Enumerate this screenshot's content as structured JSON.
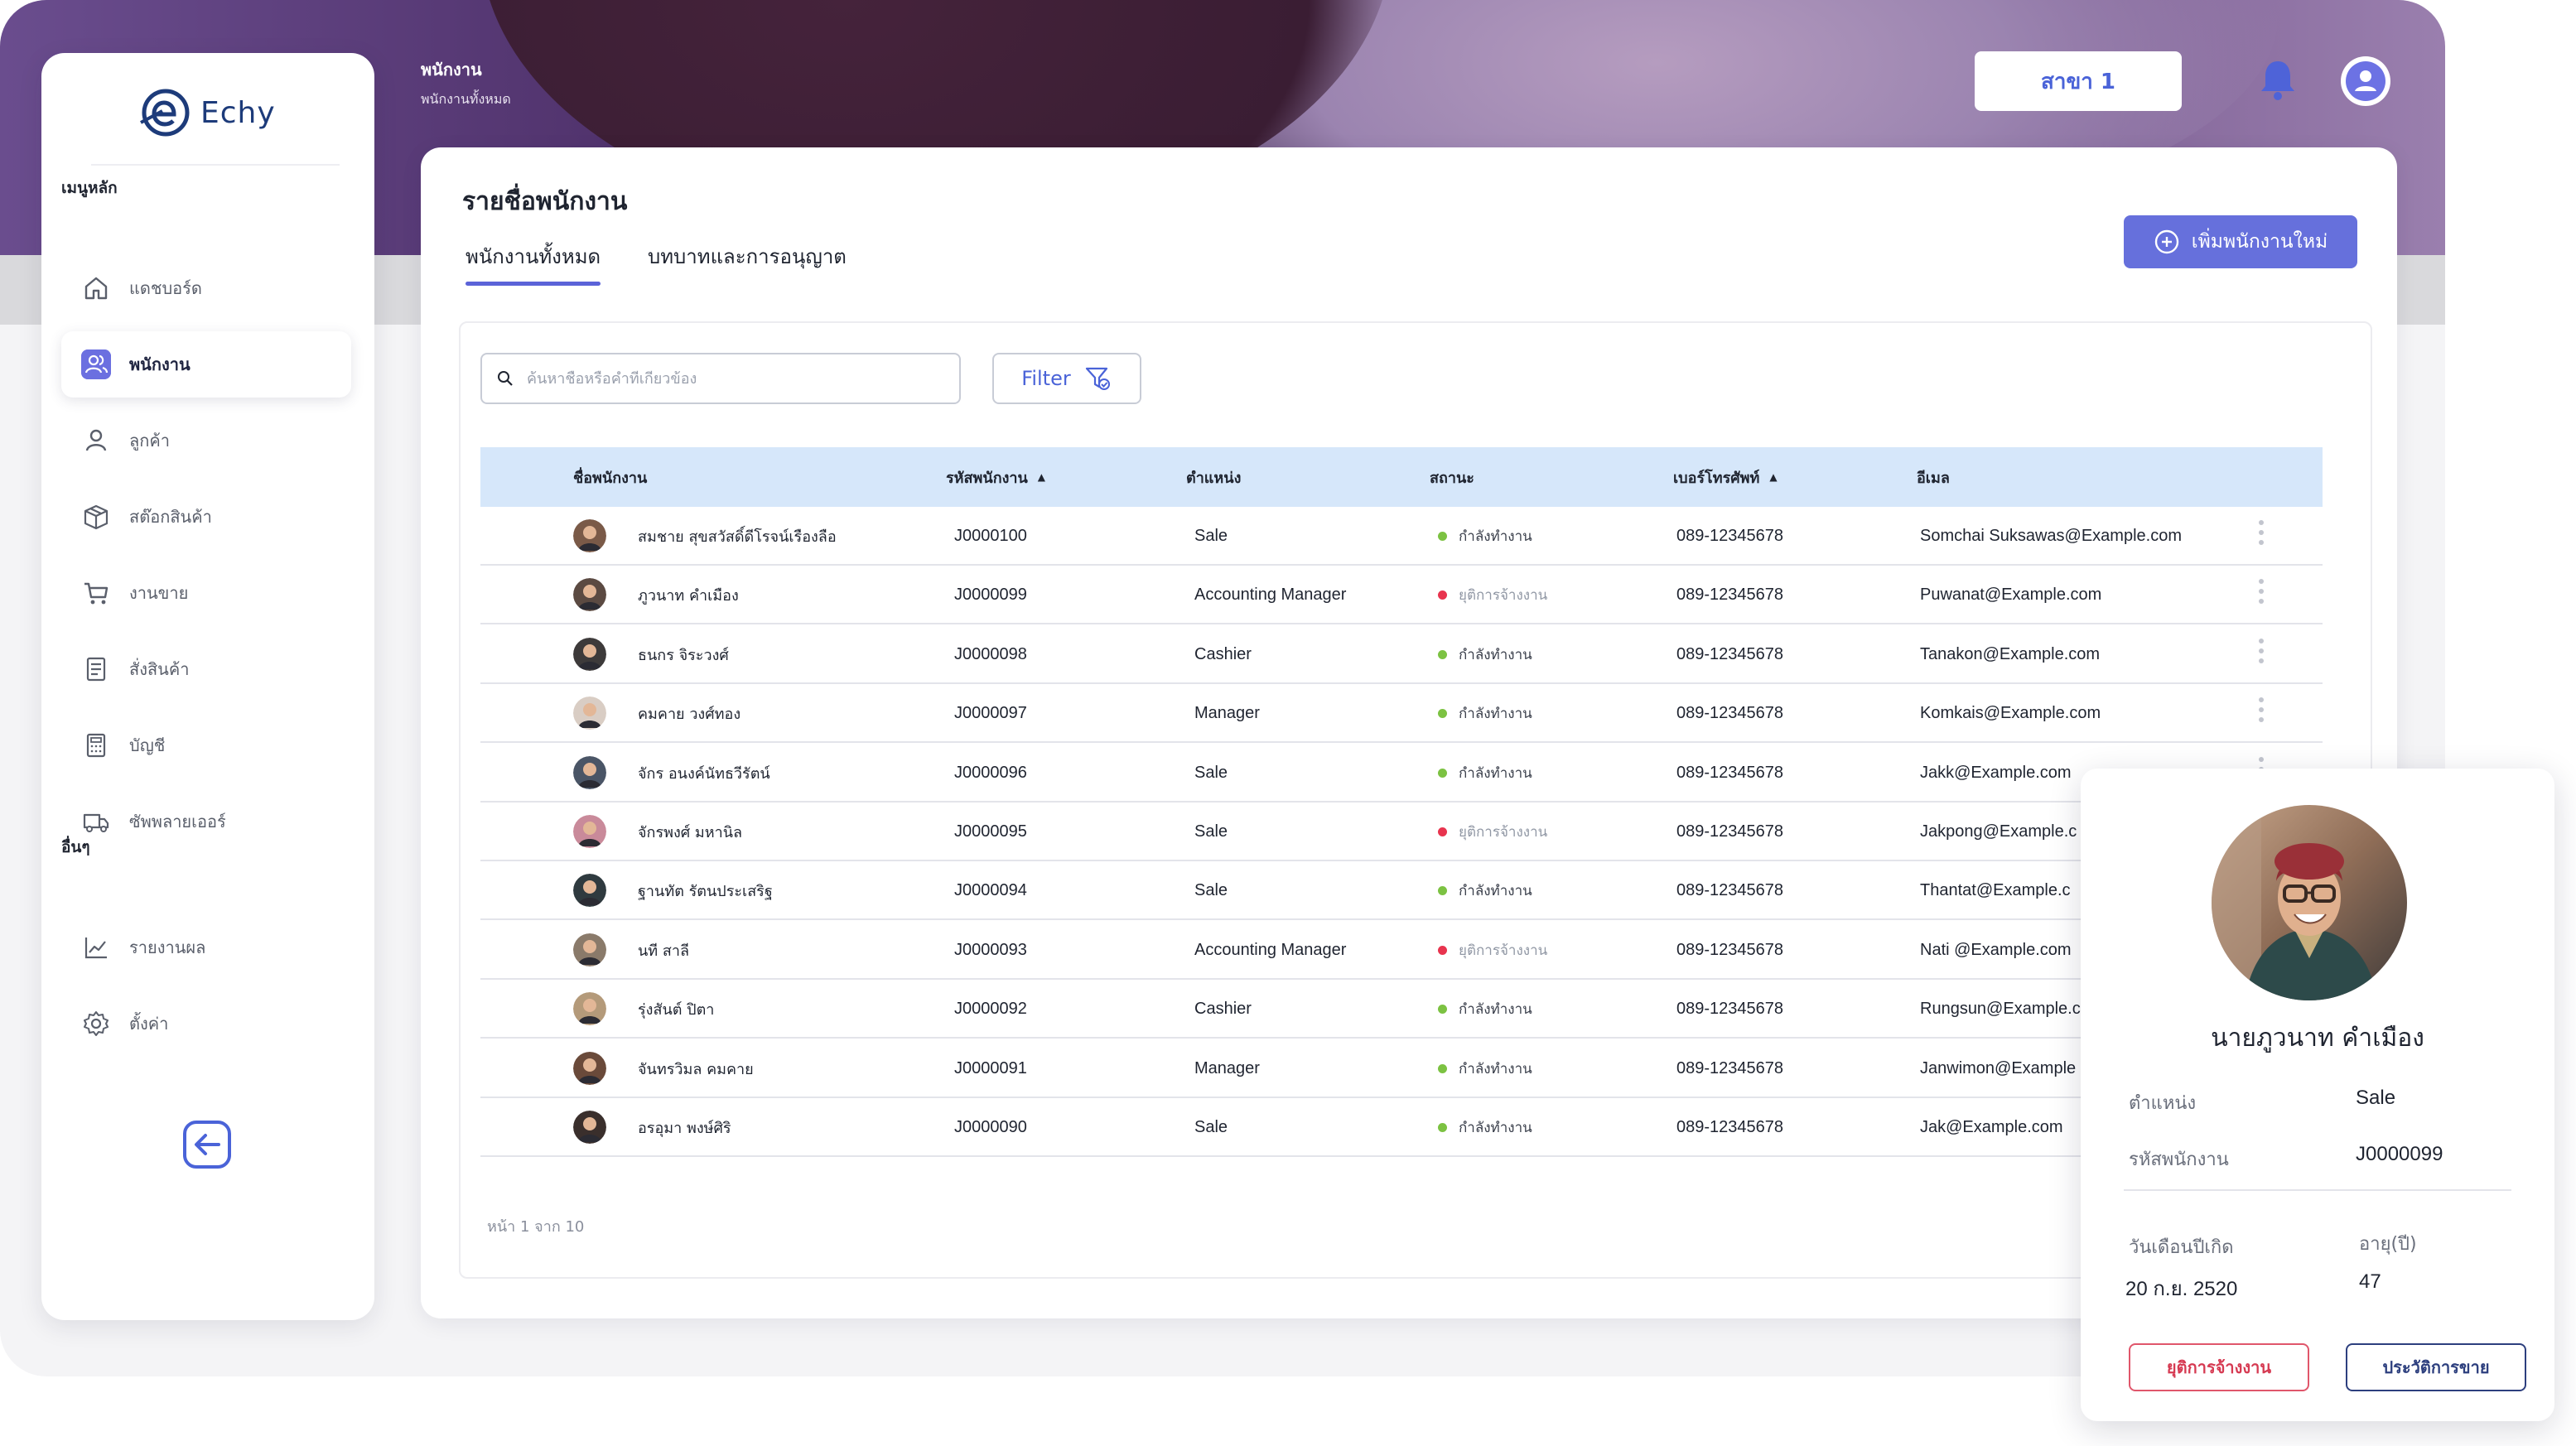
{
  "brand": {
    "name": "Echy",
    "color": "#1d3b7a"
  },
  "header": {
    "title": "พนักงาน",
    "subtitle": "พนักงานทั้งหมด",
    "branch_label": "สาขา 1"
  },
  "sidebar": {
    "section_main": "เมนูหลัก",
    "section_other": "อื่นๆ",
    "items": [
      {
        "label": "แดชบอร์ด",
        "icon": "home-icon"
      },
      {
        "label": "พนักงาน",
        "icon": "users-icon",
        "active": true
      },
      {
        "label": "ลูกค้า",
        "icon": "user-icon"
      },
      {
        "label": "สต๊อกสินค้า",
        "icon": "box-icon"
      },
      {
        "label": "งานขาย",
        "icon": "cart-icon"
      },
      {
        "label": "สั่งสินค้า",
        "icon": "order-list-icon"
      },
      {
        "label": "บัญชี",
        "icon": "calculator-icon"
      },
      {
        "label": "ซัพพลายเออร์",
        "icon": "truck-icon"
      }
    ],
    "other_items": [
      {
        "label": "รายงานผล",
        "icon": "chart-line-icon"
      },
      {
        "label": "ตั้งค่า",
        "icon": "settings-icon"
      }
    ]
  },
  "main": {
    "title": "รายชื่อพนักงาน",
    "tabs": [
      "พนักงานทั้งหมด",
      "บทบาทและการอนุญาต"
    ],
    "add_button": "เพิ่มพนักงานใหม่",
    "search_placeholder": "ค้นหาชื่อหรือคำที่เกี่ยวข้อง",
    "filter_label": "Filter",
    "columns": [
      "ชื่อพนักงาน",
      "รหัสพนักงาน",
      "ตำแหน่ง",
      "สถานะ",
      "เบอร์โทรศัพท์",
      "อีเมล"
    ],
    "pager": "หน้า 1 จาก 10"
  },
  "status_colors": {
    "active": "#7cc242",
    "terminated": "#e8344e"
  },
  "rows": [
    {
      "name": "สมชาย สุขสวัสดิ์ดีโรจน์เรืองลือ",
      "id": "J0000100",
      "position": "Sale",
      "status": "กำลังทำงาน",
      "active": true,
      "phone": "089-12345678",
      "email": "Somchai Suksawas@Example.com"
    },
    {
      "name": "ภูวนาท คำเมือง",
      "id": "J0000099",
      "position": "Accounting Manager",
      "status": "ยุติการจ้างงาน",
      "active": false,
      "phone": "089-12345678",
      "email": "Puwanat@Example.com"
    },
    {
      "name": "ธนกร จิระวงศ์",
      "id": "J0000098",
      "position": "Cashier",
      "status": "กำลังทำงาน",
      "active": true,
      "phone": "089-12345678",
      "email": "Tanakon@Example.com"
    },
    {
      "name": "คมคาย วงศ์ทอง",
      "id": "J0000097",
      "position": "Manager",
      "status": "กำลังทำงาน",
      "active": true,
      "phone": "089-12345678",
      "email": "Komkais@Example.com"
    },
    {
      "name": "จักร อนงค์นัทธวีรัตน์",
      "id": "J0000096",
      "position": "Sale",
      "status": "กำลังทำงาน",
      "active": true,
      "phone": "089-12345678",
      "email": "Jakk@Example.com"
    },
    {
      "name": "จักรพงศ์ มหานิล",
      "id": "J0000095",
      "position": "Sale",
      "status": "ยุติการจ้างงาน",
      "active": false,
      "phone": "089-12345678",
      "email": "Jakpong@Example.c"
    },
    {
      "name": "ฐานทัต รัตนประเสริฐ",
      "id": "J0000094",
      "position": "Sale",
      "status": "กำลังทำงาน",
      "active": true,
      "phone": "089-12345678",
      "email": "Thantat@Example.c"
    },
    {
      "name": "นที สาลี",
      "id": "J0000093",
      "position": "Accounting Manager",
      "status": "ยุติการจ้างงาน",
      "active": false,
      "phone": "089-12345678",
      "email": "Nati @Example.com"
    },
    {
      "name": "รุ่งสันต์ ปิตา",
      "id": "J0000092",
      "position": "Cashier",
      "status": "กำลังทำงาน",
      "active": true,
      "phone": "089-12345678",
      "email": "Rungsun@Example.c"
    },
    {
      "name": "จันทรวิมล คมคาย",
      "id": "J0000091",
      "position": "Manager",
      "status": "กำลังทำงาน",
      "active": true,
      "phone": "089-12345678",
      "email": "Janwimon@Example"
    },
    {
      "name": "อรอุมา พงษ์ศิริ",
      "id": "J0000090",
      "position": "Sale",
      "status": "กำลังทำงาน",
      "active": true,
      "phone": "089-12345678",
      "email": "Jak@Example.com"
    }
  ],
  "profile": {
    "name": "นายภูวนาท คำเมือง",
    "position_label": "ตำแหน่ง",
    "position_value": "Sale",
    "id_label": "รหัสพนักงาน",
    "id_value": "J0000099",
    "birth_label": "วันเดือนปีเกิด",
    "birth_value": "20 ก.ย. 2520",
    "age_label": "อายุ(ปี)",
    "age_value": "47",
    "terminate_button": "ยุติการจ้างงาน",
    "history_button": "ประวัติการขาย"
  }
}
